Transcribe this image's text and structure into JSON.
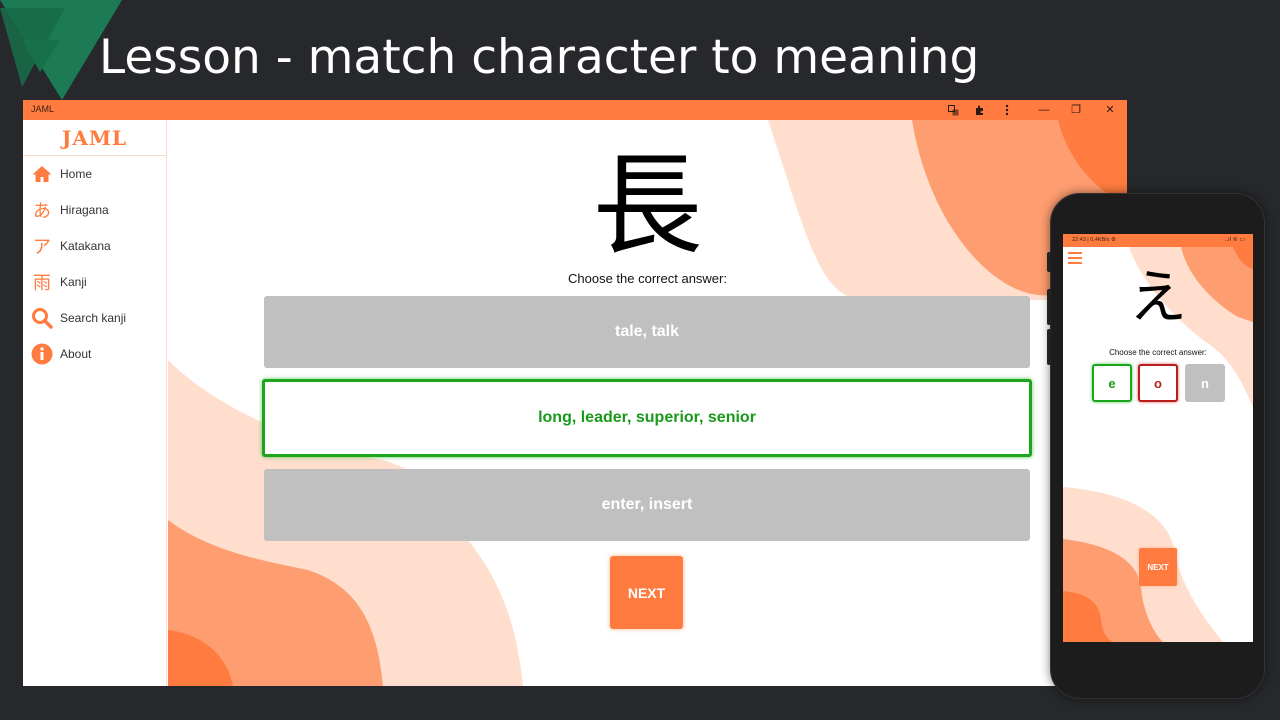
{
  "slide": {
    "title": "Lesson - match character to meaning"
  },
  "colors": {
    "accent": "#ff7b3f",
    "accent_light": "#fe9d6f",
    "accent_pale": "#ffdecd",
    "correct": "#1ea51e",
    "wrong": "#b81e1e",
    "neutral": "#bfc0bf"
  },
  "window": {
    "app_name": "JAML",
    "icons": [
      "translate-icon",
      "extensions-icon",
      "more-vertical-icon"
    ],
    "controls": {
      "minimize": "—",
      "restore": "❐",
      "close": "✕"
    }
  },
  "sidebar": {
    "logo": "JAML",
    "items": [
      {
        "label": "Home",
        "icon": "home-icon",
        "glyph": "⌂"
      },
      {
        "label": "Hiragana",
        "icon": "hiragana-icon",
        "glyph": "あ"
      },
      {
        "label": "Katakana",
        "icon": "katakana-icon",
        "glyph": "ア"
      },
      {
        "label": "Kanji",
        "icon": "kanji-icon",
        "glyph": "雨"
      },
      {
        "label": "Search kanji",
        "icon": "search-icon",
        "glyph": ""
      },
      {
        "label": "About",
        "icon": "info-icon",
        "glyph": "i"
      }
    ]
  },
  "lesson": {
    "character": "長",
    "prompt": "Choose the correct answer:",
    "answers": [
      {
        "text": "tale, talk",
        "state": "neutral"
      },
      {
        "text": "long, leader, superior, senior",
        "state": "correct"
      },
      {
        "text": "enter, insert",
        "state": "neutral"
      }
    ],
    "next_label": "NEXT"
  },
  "phone": {
    "status_time": "22:43 | 0,4KB/s ⚙",
    "status_right": "..ıl ≋ ▭",
    "character": "え",
    "prompt": "Choose the correct answer:",
    "options": [
      {
        "text": "e",
        "state": "correct"
      },
      {
        "text": "o",
        "state": "wrong"
      },
      {
        "text": "n",
        "state": "neutral"
      }
    ],
    "next_label": "NEXT"
  }
}
